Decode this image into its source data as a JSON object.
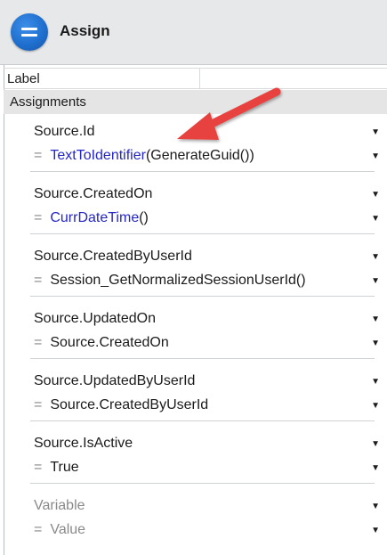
{
  "header": {
    "title": "Assign",
    "icon": "assign-equals-icon",
    "icon_color": "#1f6fcf"
  },
  "properties": {
    "label_field": "Label",
    "section_title": "Assignments",
    "assignments": [
      {
        "variable": "Source.Id",
        "value_fn": "TextToIdentifier",
        "value_rest": "(GenerateGuid())"
      },
      {
        "variable": "Source.CreatedOn",
        "value_fn": "CurrDateTime",
        "value_rest": "()"
      },
      {
        "variable": "Source.CreatedByUserId",
        "value_fn": "",
        "value_rest": "Session_GetNormalizedSessionUserId()"
      },
      {
        "variable": "Source.UpdatedOn",
        "value_fn": "",
        "value_rest": "Source.CreatedOn"
      },
      {
        "variable": "Source.UpdatedByUserId",
        "value_fn": "",
        "value_rest": "Source.CreatedByUserId"
      },
      {
        "variable": "Source.IsActive",
        "value_fn": "",
        "value_rest": "True"
      }
    ],
    "new_assignment": {
      "variable_placeholder": "Variable",
      "value_placeholder": "Value"
    },
    "equals_sign": "=",
    "dropdown_icon": "caret-down-icon"
  },
  "colors": {
    "function": "#2426c6",
    "placeholder": "#8a8a8a",
    "annotation_arrow": "#e8423f"
  }
}
